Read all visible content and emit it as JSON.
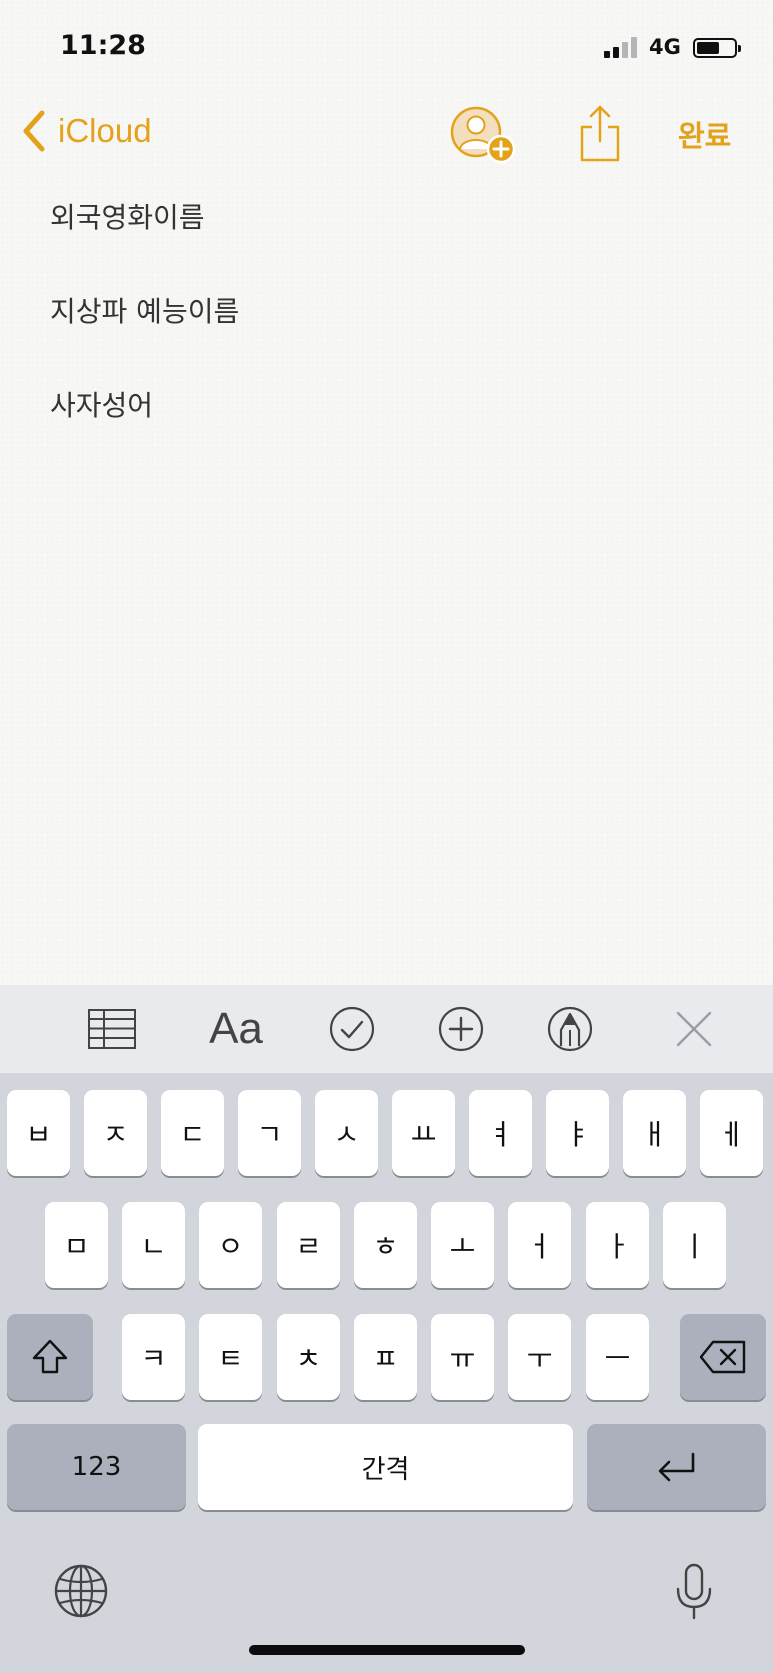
{
  "status_bar": {
    "time": "11:28",
    "network": "4G"
  },
  "nav": {
    "back_label": "iCloud",
    "done_label": "완료"
  },
  "note": {
    "lines": [
      "외국영화이름",
      "지상파 예능이름",
      "사자성어"
    ]
  },
  "toolbar": {
    "format_label": "Aa"
  },
  "keyboard": {
    "row1": [
      "ㅂ",
      "ㅈ",
      "ㄷ",
      "ㄱ",
      "ㅅ",
      "ㅛ",
      "ㅕ",
      "ㅑ",
      "ㅐ",
      "ㅔ"
    ],
    "row2": [
      "ㅁ",
      "ㄴ",
      "ㅇ",
      "ㄹ",
      "ㅎ",
      "ㅗ",
      "ㅓ",
      "ㅏ",
      "ㅣ"
    ],
    "row3": [
      "ㅋ",
      "ㅌ",
      "ㅊ",
      "ㅍ",
      "ㅠ",
      "ㅜ",
      "ㅡ"
    ],
    "numbers_label": "123",
    "space_label": "간격"
  },
  "colors": {
    "accent": "#e3a21a",
    "keyboard_bg": "#d3d5dc",
    "function_key": "#abb0bc"
  }
}
